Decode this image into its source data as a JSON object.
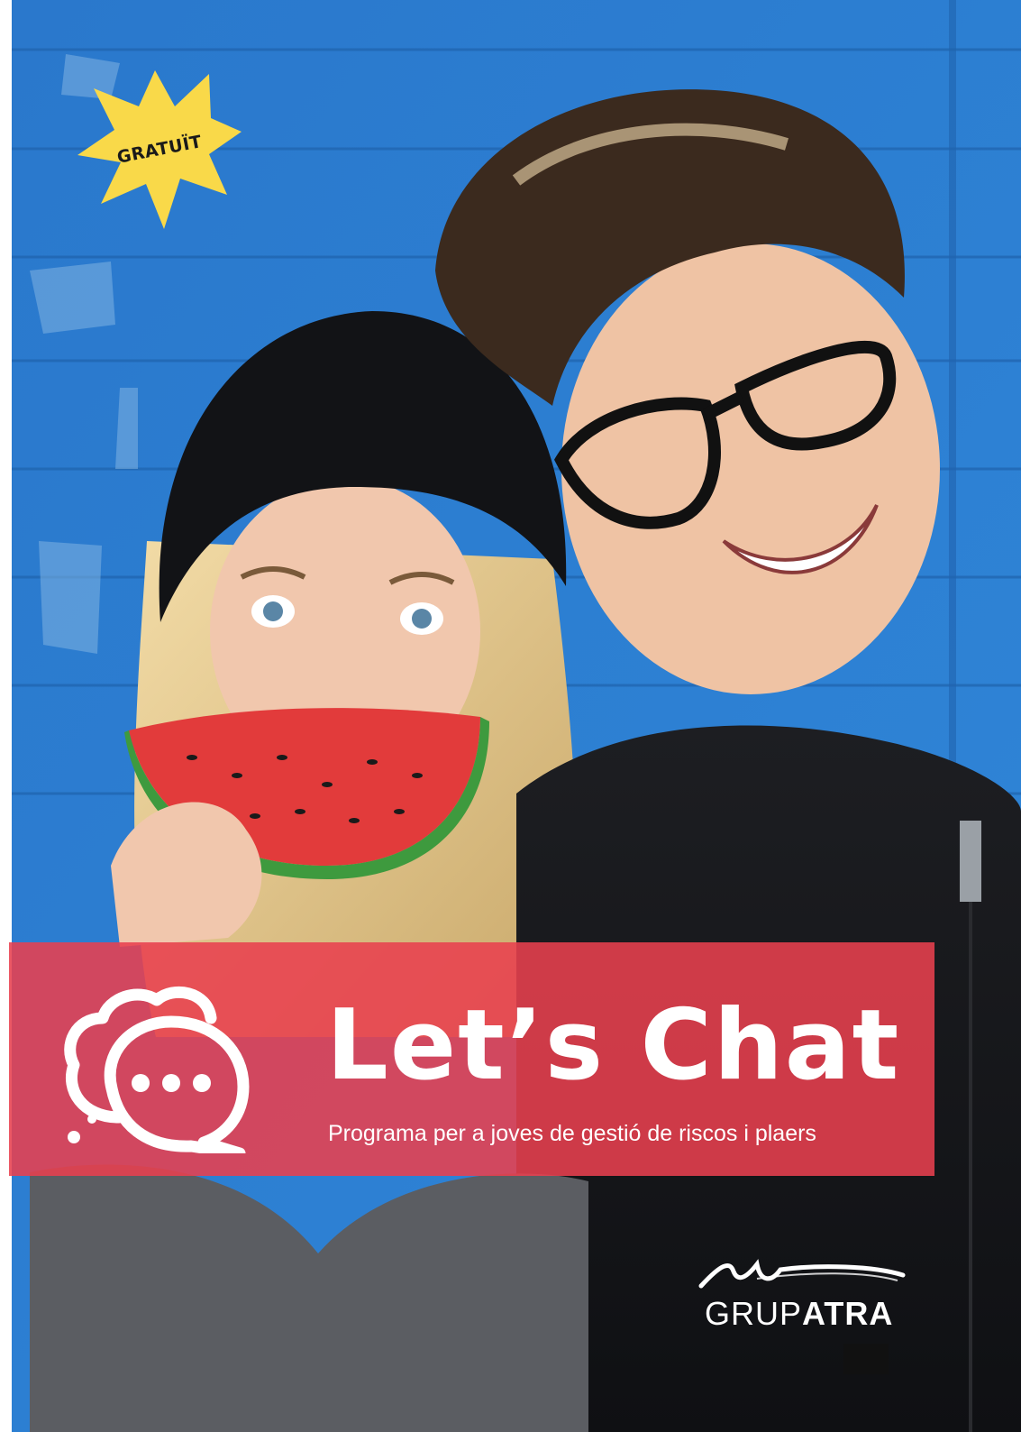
{
  "badge": {
    "text": "GRATUÏT",
    "color": "#f9d949"
  },
  "banner": {
    "title": "Let’s Chat",
    "subtitle": "Programa per a joves de gestió de riscos i plaers",
    "background": "#e8404e",
    "icon": "chat-bubbles-icon"
  },
  "logo": {
    "word_light": "GRUP",
    "word_bold": "ATRA"
  },
  "photo": {
    "description_icon": "teens-photo",
    "wall_color": "#2f7fcf"
  }
}
